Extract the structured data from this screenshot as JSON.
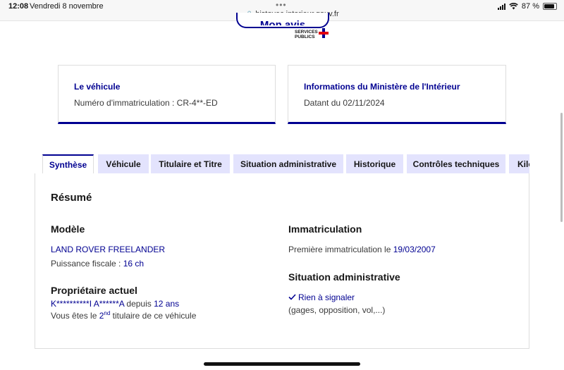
{
  "status_bar": {
    "time": "12:08",
    "date": "Vendredi 8 novembre",
    "url": "histovec.interieur.gouv.fr",
    "battery": "87 %"
  },
  "header": {
    "button_label": "Mon avis",
    "logo_line1": "SERVICES",
    "logo_line2": "PUBLICS"
  },
  "cards": {
    "vehicle": {
      "title": "Le véhicule",
      "text": "Numéro d'immatriculation : CR-4**-ED"
    },
    "ministry": {
      "title": "Informations du Ministère de l'Intérieur",
      "text": "Datant du 02/11/2024"
    }
  },
  "tabs": [
    {
      "label": "Synthèse"
    },
    {
      "label": "Véhicule"
    },
    {
      "label": "Titulaire et Titre"
    },
    {
      "label": "Situation administrative"
    },
    {
      "label": "Historique"
    },
    {
      "label": "Contrôles techniques"
    },
    {
      "label": "Kilométrage"
    }
  ],
  "summary": {
    "title": "Résumé",
    "model": {
      "heading": "Modèle",
      "name": "LAND ROVER FREELANDER",
      "power_label": "Puissance fiscale : ",
      "power_value": "16 ch"
    },
    "owner": {
      "heading": "Propriétaire actuel",
      "name": "K**********I A******A",
      "since_label": " depuis ",
      "since_value": "12 ans",
      "holder_prefix": "Vous êtes le ",
      "holder_rank": "2",
      "holder_rank_sup": "nd",
      "holder_suffix": " titulaire de ce véhicule"
    },
    "registration": {
      "heading": "Immatriculation",
      "first_label": "Première immatriculation le ",
      "first_date": "19/03/2007"
    },
    "admin": {
      "heading": "Situation administrative",
      "status": "Rien à signaler",
      "details": "(gages, opposition, vol,...)"
    }
  },
  "colors": {
    "accent": "#000091",
    "tab_bg": "#e3e3fd"
  }
}
